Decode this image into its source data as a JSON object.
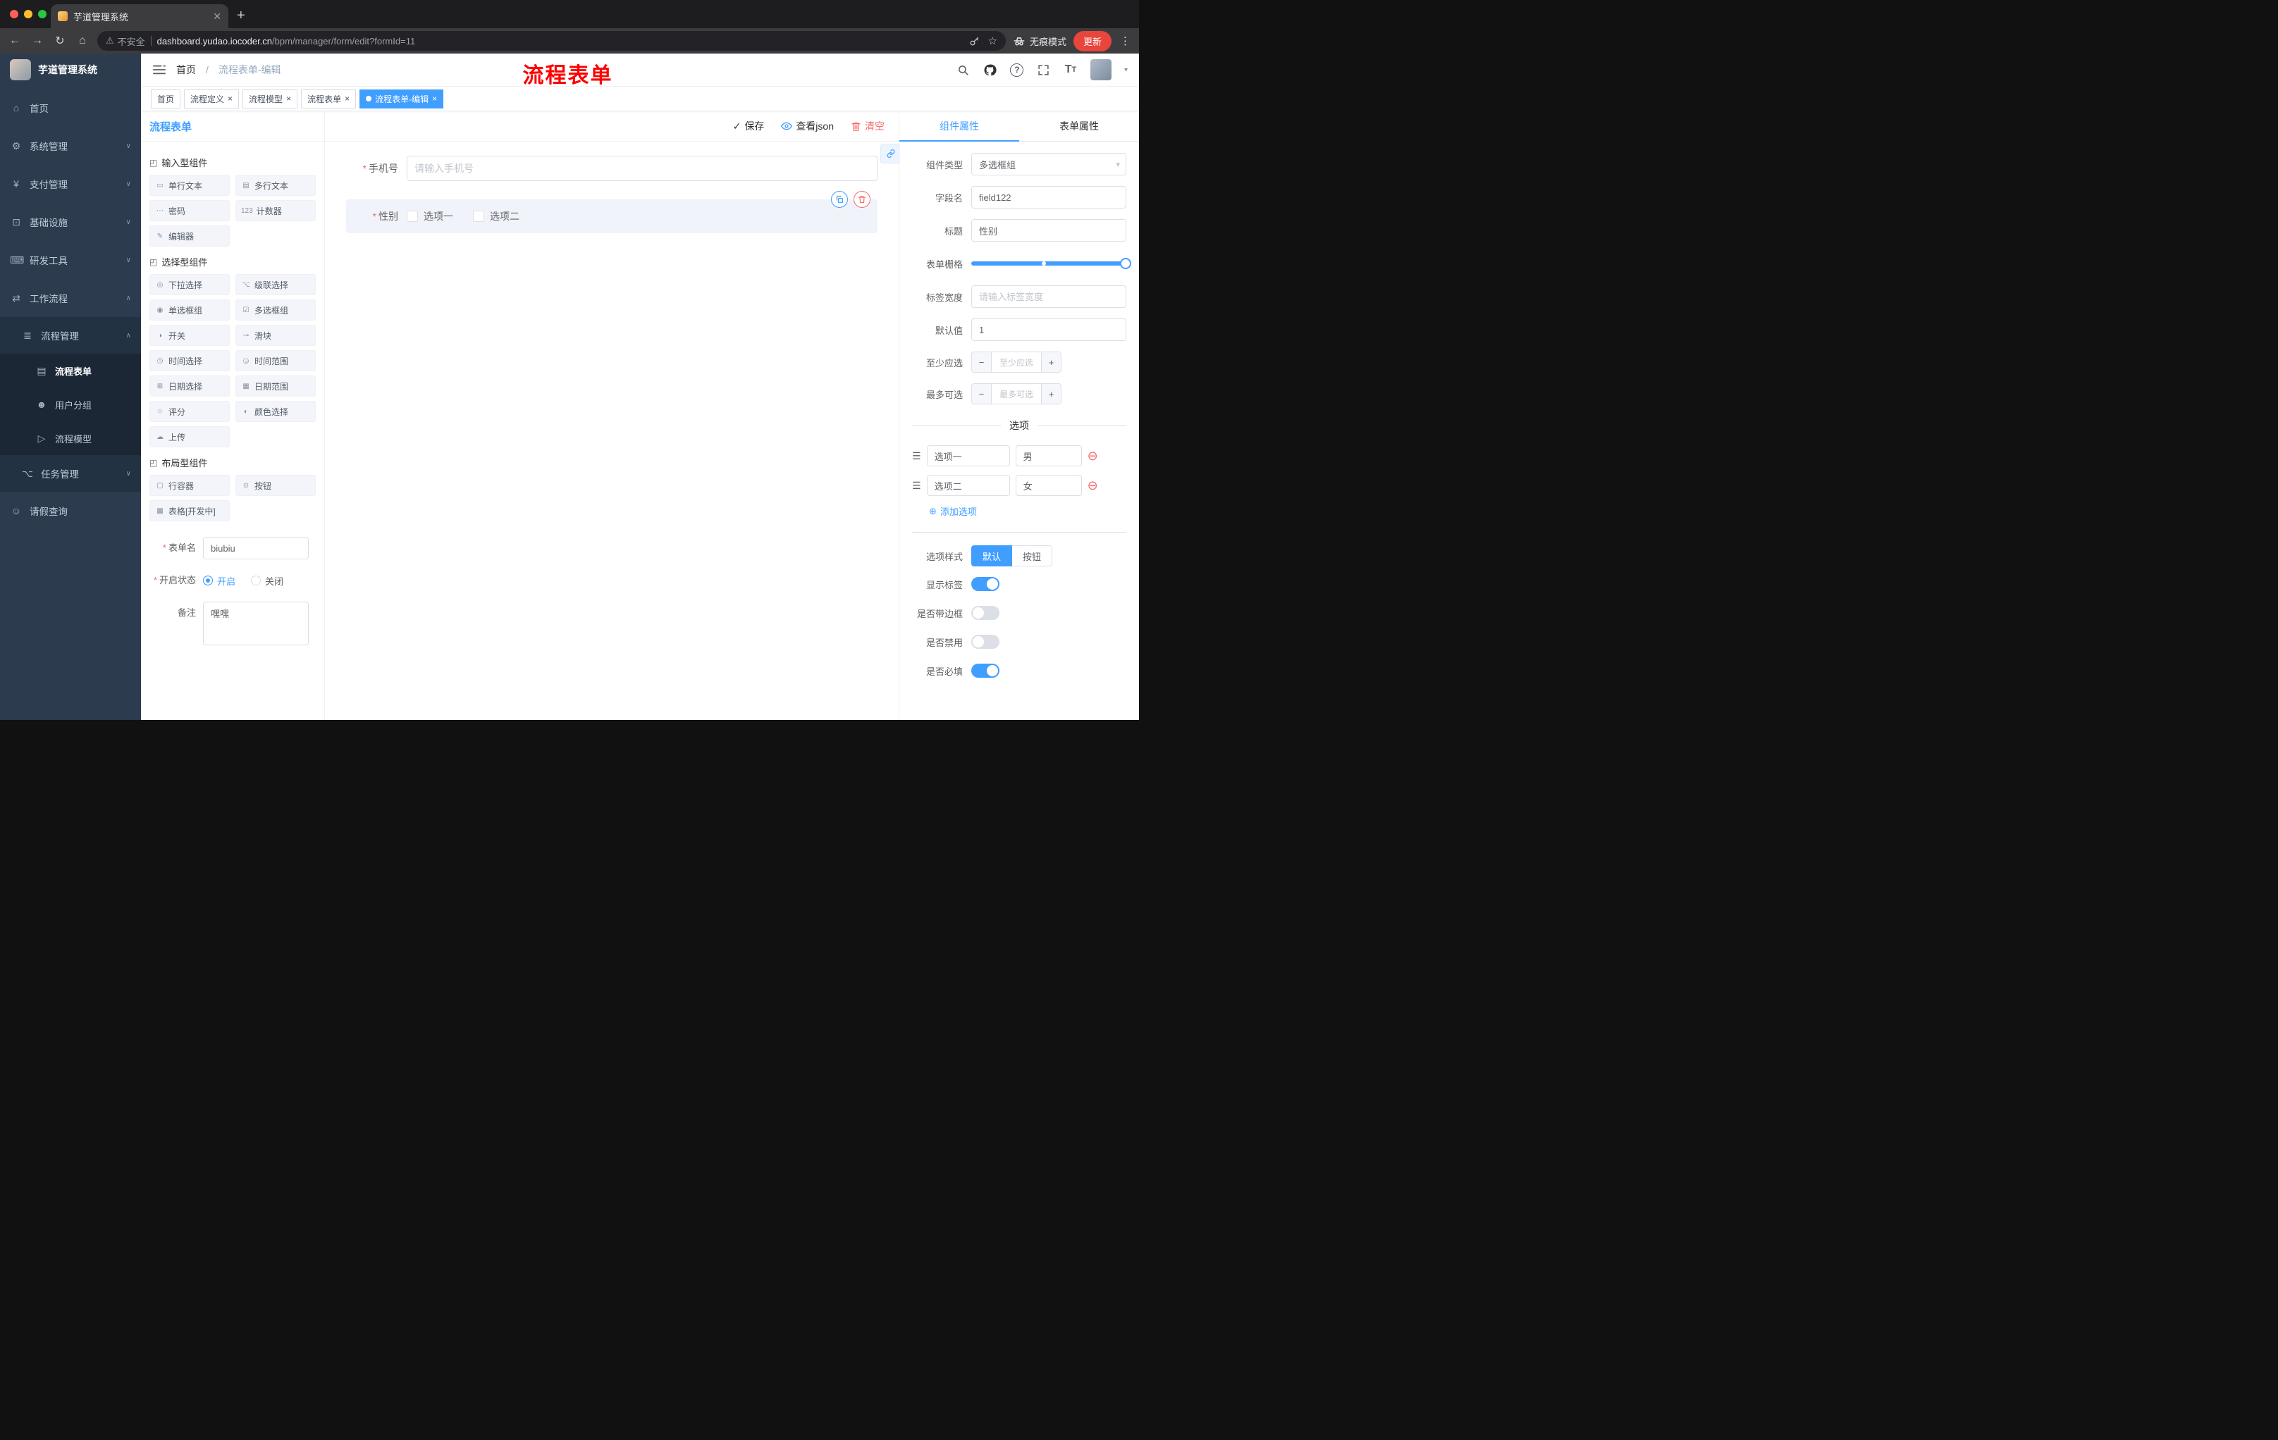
{
  "colors": {
    "accent": "#409eff",
    "danger": "#f56c6c",
    "update_button": "#e8453c",
    "sidebar_bg": "#2c3b4e"
  },
  "browser": {
    "tab_title": "芋道管理系统",
    "address": {
      "warning": "不安全",
      "domain": "dashboard.yudao.iocoder.cn",
      "path": "/bpm/manager/form/edit?formId=11"
    },
    "incognito_label": "无痕模式",
    "update_label": "更新"
  },
  "sidebar": {
    "title": "芋道管理系统",
    "items": [
      {
        "icon": "⌂",
        "label": "首页",
        "cls": "l1"
      },
      {
        "icon": "⚙",
        "label": "系统管理",
        "cls": "l1",
        "chevron": "∨"
      },
      {
        "icon": "¥",
        "label": "支付管理",
        "cls": "l1",
        "chevron": "∨"
      },
      {
        "icon": "⊡",
        "label": "基础设施",
        "cls": "l1",
        "chevron": "∨"
      },
      {
        "icon": "⌨",
        "label": "研发工具",
        "cls": "l1",
        "chevron": "∨"
      },
      {
        "icon": "⇄",
        "label": "工作流程",
        "cls": "l1 open",
        "chevron": "∧"
      },
      {
        "icon": "≣",
        "label": "流程管理",
        "cls": "l2",
        "chevron": "∧"
      },
      {
        "icon": "▤",
        "label": "流程表单",
        "cls": "l3 active"
      },
      {
        "icon": "☻",
        "label": "用户分组",
        "cls": "l3"
      },
      {
        "icon": "▷",
        "label": "流程模型",
        "cls": "l3"
      },
      {
        "icon": "⌥",
        "label": "任务管理",
        "cls": "l2",
        "chevron": "∨"
      },
      {
        "icon": "☺",
        "label": "请假查询",
        "cls": "l1"
      }
    ]
  },
  "header": {
    "breadcrumb_home": "首页",
    "breadcrumb_sep": "/",
    "breadcrumb_current": "流程表单-编辑",
    "annotation": "流程表单"
  },
  "tags": [
    {
      "label": "首页"
    },
    {
      "label": "流程定义",
      "closable": true
    },
    {
      "label": "流程模型",
      "closable": true
    },
    {
      "label": "流程表单",
      "closable": true
    },
    {
      "label": "流程表单-编辑",
      "closable": true,
      "active": true,
      "cls": "active"
    }
  ],
  "left_panel": {
    "title": "流程表单",
    "group_input": {
      "icon": "◰",
      "title": "输入型组件",
      "items": [
        {
          "icon": "▭",
          "label": "单行文本"
        },
        {
          "icon": "▤",
          "label": "多行文本"
        },
        {
          "icon": "⋯",
          "label": "密码"
        },
        {
          "icon": "123",
          "label": "计数器"
        },
        {
          "icon": "✎",
          "label": "编辑器"
        }
      ]
    },
    "group_select": {
      "icon": "◰",
      "title": "选择型组件",
      "items": [
        {
          "icon": "◎",
          "label": "下拉选择"
        },
        {
          "icon": "⌥",
          "label": "级联选择"
        },
        {
          "icon": "◉",
          "label": "单选框组"
        },
        {
          "icon": "☑",
          "label": "多选框组"
        },
        {
          "icon": "◑",
          "label": "开关"
        },
        {
          "icon": "⊸",
          "label": "滑块"
        },
        {
          "icon": "◷",
          "label": "时间选择"
        },
        {
          "icon": "◶",
          "label": "时间范围"
        },
        {
          "icon": "⊞",
          "label": "日期选择"
        },
        {
          "icon": "▦",
          "label": "日期范围"
        },
        {
          "icon": "☆",
          "label": "评分"
        },
        {
          "icon": "◐",
          "label": "颜色选择"
        },
        {
          "icon": "☁",
          "label": "上传"
        }
      ]
    },
    "group_layout": {
      "icon": "◰",
      "title": "布局型组件",
      "items": [
        {
          "icon": "▢",
          "label": "行容器"
        },
        {
          "icon": "⊙",
          "label": "按钮"
        },
        {
          "icon": "▩",
          "label": "表格[开发中]"
        }
      ]
    },
    "form": {
      "name_label": "表单名",
      "name_value": "biubiu",
      "status_label": "开启状态",
      "status_on": "开启",
      "status_off": "关闭",
      "remark_label": "备注",
      "remark_value": "嘿嘿"
    }
  },
  "canvas": {
    "save_label": "保存",
    "view_json_label": "查看json",
    "clear_label": "清空",
    "phone_field": {
      "label": "手机号",
      "placeholder": "请输入手机号"
    },
    "gender_field": {
      "label": "性别",
      "options": [
        "选项一",
        "选项二"
      ]
    }
  },
  "inspector": {
    "tab_component": "组件属性",
    "tab_form": "表单属性",
    "component_type": {
      "label": "组件类型",
      "value": "多选框组"
    },
    "field_name": {
      "label": "字段名",
      "value": "field122"
    },
    "title": {
      "label": "标题",
      "value": "性别"
    },
    "grid": {
      "label": "表单栅格"
    },
    "label_width": {
      "label": "标签宽度",
      "placeholder": "请输入标签宽度"
    },
    "default_value": {
      "label": "默认值",
      "value": "1"
    },
    "min_select": {
      "label": "至少应选",
      "placeholder": "至少应选"
    },
    "max_select": {
      "label": "最多可选",
      "placeholder": "最多可选"
    },
    "options_title": "选项",
    "options": [
      {
        "label": "选项一",
        "value": "男"
      },
      {
        "label": "选项二",
        "value": "女"
      }
    ],
    "add_option_label": "添加选项",
    "style": {
      "label": "选项样式",
      "default": "默认",
      "button": "按钮"
    },
    "switches": [
      {
        "label": "显示标签",
        "cls": "on"
      },
      {
        "label": "是否带边框"
      },
      {
        "label": "是否禁用"
      },
      {
        "label": "是否必填",
        "cls": "on"
      }
    ]
  }
}
